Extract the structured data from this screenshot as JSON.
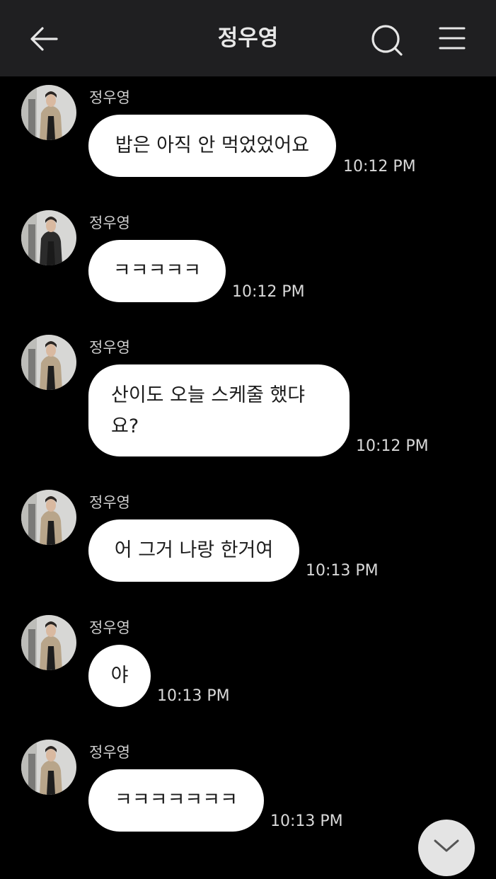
{
  "header": {
    "title": "정우영",
    "back_icon": "arrow-left-icon",
    "search_icon": "search-icon",
    "menu_icon": "hamburger-menu-icon"
  },
  "messages": [
    {
      "sender": "정우영",
      "text": "밥은 아직 안 먹었었어요",
      "time": "10:12 PM"
    },
    {
      "sender": "정우영",
      "text": "ㅋㅋㅋㅋㅋ",
      "time": "10:12 PM"
    },
    {
      "sender": "정우영",
      "text_line1": "산이도 오늘 스케줄 했댜",
      "text_line2": "요?",
      "time": "10:12 PM"
    },
    {
      "sender": "정우영",
      "text": "어 그거 나랑 한거여",
      "time": "10:13 PM"
    },
    {
      "sender": "정우영",
      "text": "야",
      "time": "10:13 PM"
    },
    {
      "sender": "정우영",
      "text": "ㅋㅋㅋㅋㅋㅋㅋ",
      "time": "10:13 PM"
    }
  ],
  "scroll_down_icon": "chevron-down-icon",
  "colors": {
    "header_bg": "#1f1f21",
    "chat_bg": "#000000",
    "bubble_bg": "#ffffff",
    "bubble_text": "#1c1c1c",
    "timestamp": "#d9d9d9"
  }
}
